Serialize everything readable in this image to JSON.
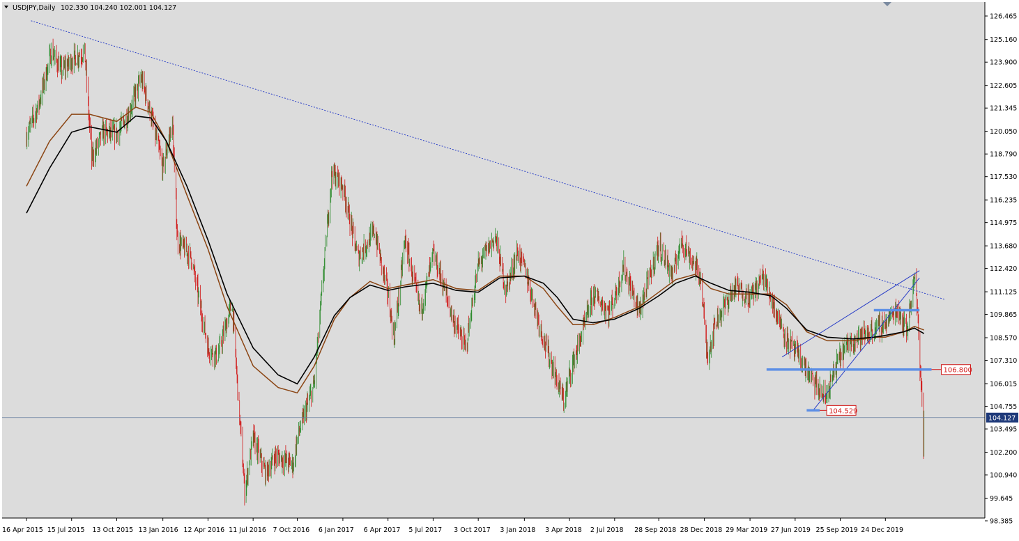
{
  "header": {
    "symbol_label": "USDJPY,Daily",
    "ohlc_label": "102.330 104.240 102.001 104.127"
  },
  "colors": {
    "background": "#dcdcdc",
    "bull": "#2e8b2e",
    "bear": "#d11a1a",
    "ma_fast": "#8b4513",
    "ma_slow": "#000000",
    "trendline": "#2a3fc7",
    "level": "#5b8ee6",
    "price_label_bg": "#1f3a7a",
    "level_label": "#d11a1a"
  },
  "chart_data": {
    "type": "candlestick",
    "symbol": "USDJPY",
    "timeframe": "Daily",
    "ohlc_last": {
      "open": 102.33,
      "high": 104.24,
      "low": 102.001,
      "close": 104.127
    },
    "ylim": [
      98.385,
      126.465
    ],
    "y_ticks": [
      "126.465",
      "125.160",
      "123.900",
      "122.605",
      "121.345",
      "120.050",
      "118.790",
      "117.530",
      "116.235",
      "114.975",
      "113.680",
      "112.420",
      "111.125",
      "109.865",
      "108.570",
      "107.310",
      "106.015",
      "104.755",
      "103.495",
      "102.200",
      "100.940",
      "99.645",
      "98.385"
    ],
    "x_ticks": [
      "16 Apr 2015",
      "15 Jul 2015",
      "13 Oct 2015",
      "13 Jan 2016",
      "12 Apr 2016",
      "11 Jul 2016",
      "7 Oct 2016",
      "6 Jan 2017",
      "6 Apr 2017",
      "5 Jul 2017",
      "3 Oct 2017",
      "3 Jan 2018",
      "3 Apr 2018",
      "2 Jul 2018",
      "28 Sep 2018",
      "28 Dec 2018",
      "29 Mar 2019",
      "27 Jun 2019",
      "25 Sep 2019",
      "24 Dec 2019"
    ],
    "close_path": [
      [
        "2015-04-16",
        119.8
      ],
      [
        "2015-05-10",
        121.5
      ],
      [
        "2015-06-05",
        124.5
      ],
      [
        "2015-06-25",
        123.4
      ],
      [
        "2015-07-15",
        124.0
      ],
      [
        "2015-08-10",
        124.5
      ],
      [
        "2015-08-24",
        118.5
      ],
      [
        "2015-09-15",
        120.0
      ],
      [
        "2015-10-13",
        119.9
      ],
      [
        "2015-11-05",
        121.0
      ],
      [
        "2015-12-01",
        123.0
      ],
      [
        "2015-12-20",
        121.0
      ],
      [
        "2016-01-13",
        118.0
      ],
      [
        "2016-02-01",
        120.5
      ],
      [
        "2016-02-11",
        114.0
      ],
      [
        "2016-03-10",
        113.0
      ],
      [
        "2016-04-12",
        108.0
      ],
      [
        "2016-05-01",
        107.5
      ],
      [
        "2016-05-30",
        110.5
      ],
      [
        "2016-06-24",
        100.0
      ],
      [
        "2016-07-11",
        103.0
      ],
      [
        "2016-08-05",
        101.0
      ],
      [
        "2016-08-25",
        102.0
      ],
      [
        "2016-09-30",
        101.5
      ],
      [
        "2016-10-07",
        103.0
      ],
      [
        "2016-11-10",
        106.0
      ],
      [
        "2016-12-15",
        117.8
      ],
      [
        "2017-01-06",
        117.0
      ],
      [
        "2017-02-05",
        113.0
      ],
      [
        "2017-03-10",
        114.5
      ],
      [
        "2017-04-06",
        111.0
      ],
      [
        "2017-04-18",
        108.5
      ],
      [
        "2017-05-10",
        114.0
      ],
      [
        "2017-06-10",
        110.0
      ],
      [
        "2017-07-05",
        113.2
      ],
      [
        "2017-07-20",
        112.0
      ],
      [
        "2017-08-15",
        109.5
      ],
      [
        "2017-09-08",
        108.0
      ],
      [
        "2017-10-03",
        112.6
      ],
      [
        "2017-11-06",
        114.2
      ],
      [
        "2017-11-27",
        111.2
      ],
      [
        "2017-12-20",
        113.3
      ],
      [
        "2018-01-03",
        112.5
      ],
      [
        "2018-02-10",
        108.5
      ],
      [
        "2018-03-23",
        105.0
      ],
      [
        "2018-04-03",
        106.5
      ],
      [
        "2018-05-21",
        111.0
      ],
      [
        "2018-06-20",
        110.0
      ],
      [
        "2018-07-02",
        110.8
      ],
      [
        "2018-07-20",
        112.5
      ],
      [
        "2018-08-20",
        110.0
      ],
      [
        "2018-09-28",
        113.7
      ],
      [
        "2018-10-26",
        112.0
      ],
      [
        "2018-11-12",
        114.0
      ],
      [
        "2018-12-20",
        112.0
      ],
      [
        "2019-01-03",
        107.5
      ],
      [
        "2019-01-20",
        109.5
      ],
      [
        "2019-02-28",
        111.4
      ],
      [
        "2019-03-29",
        110.8
      ],
      [
        "2019-04-24",
        112.0
      ],
      [
        "2019-05-20",
        110.0
      ],
      [
        "2019-06-10",
        108.5
      ],
      [
        "2019-06-27",
        107.8
      ],
      [
        "2019-08-05",
        106.0
      ],
      [
        "2019-08-26",
        105.2
      ],
      [
        "2019-09-25",
        107.6
      ],
      [
        "2019-10-20",
        108.5
      ],
      [
        "2019-11-20",
        108.8
      ],
      [
        "2019-12-24",
        109.4
      ],
      [
        "2020-01-17",
        110.2
      ],
      [
        "2020-02-05",
        109.0
      ],
      [
        "2020-02-20",
        112.0
      ],
      [
        "2020-02-26",
        110.0
      ],
      [
        "2020-03-02",
        107.0
      ],
      [
        "2020-03-06",
        105.3
      ],
      [
        "2020-03-09",
        102.2
      ],
      [
        "2020-03-10",
        104.127
      ]
    ],
    "ma_slow_path": [
      [
        "2015-04-16",
        115.5
      ],
      [
        "2015-06-01",
        118.0
      ],
      [
        "2015-07-15",
        120.0
      ],
      [
        "2015-08-20",
        120.3
      ],
      [
        "2015-10-13",
        120.0
      ],
      [
        "2015-11-20",
        120.9
      ],
      [
        "2015-12-20",
        120.8
      ],
      [
        "2016-01-20",
        119.5
      ],
      [
        "2016-03-01",
        117.0
      ],
      [
        "2016-04-12",
        114.0
      ],
      [
        "2016-05-20",
        111.0
      ],
      [
        "2016-07-11",
        108.0
      ],
      [
        "2016-08-30",
        106.5
      ],
      [
        "2016-10-07",
        106.0
      ],
      [
        "2016-11-10",
        107.5
      ],
      [
        "2016-12-20",
        109.8
      ],
      [
        "2017-01-20",
        110.8
      ],
      [
        "2017-03-01",
        111.5
      ],
      [
        "2017-04-06",
        111.2
      ],
      [
        "2017-05-10",
        111.4
      ],
      [
        "2017-07-05",
        111.6
      ],
      [
        "2017-08-20",
        111.2
      ],
      [
        "2017-10-03",
        111.1
      ],
      [
        "2017-11-15",
        111.9
      ],
      [
        "2018-01-03",
        112.0
      ],
      [
        "2018-02-10",
        111.6
      ],
      [
        "2018-03-10",
        110.8
      ],
      [
        "2018-04-10",
        109.6
      ],
      [
        "2018-05-20",
        109.4
      ],
      [
        "2018-07-02",
        109.6
      ],
      [
        "2018-08-20",
        110.2
      ],
      [
        "2018-09-28",
        110.9
      ],
      [
        "2018-11-01",
        111.6
      ],
      [
        "2018-12-10",
        112.0
      ],
      [
        "2019-01-10",
        111.6
      ],
      [
        "2019-02-15",
        111.2
      ],
      [
        "2019-03-29",
        111.1
      ],
      [
        "2019-05-10",
        110.9
      ],
      [
        "2019-06-10",
        110.2
      ],
      [
        "2019-07-20",
        109.0
      ],
      [
        "2019-08-30",
        108.6
      ],
      [
        "2019-10-20",
        108.5
      ],
      [
        "2019-12-01",
        108.6
      ],
      [
        "2019-12-24",
        108.7
      ],
      [
        "2020-01-30",
        108.9
      ],
      [
        "2020-02-20",
        109.1
      ],
      [
        "2020-03-10",
        108.8
      ]
    ],
    "ma_fast_path": [
      [
        "2015-04-16",
        117.0
      ],
      [
        "2015-06-01",
        119.5
      ],
      [
        "2015-07-15",
        121.0
      ],
      [
        "2015-08-20",
        121.0
      ],
      [
        "2015-10-13",
        120.6
      ],
      [
        "2015-11-20",
        121.4
      ],
      [
        "2015-12-20",
        121.1
      ],
      [
        "2016-01-20",
        119.5
      ],
      [
        "2016-03-01",
        116.5
      ],
      [
        "2016-04-12",
        113.5
      ],
      [
        "2016-05-20",
        110.3
      ],
      [
        "2016-07-11",
        107.0
      ],
      [
        "2016-08-30",
        105.8
      ],
      [
        "2016-10-07",
        105.5
      ],
      [
        "2016-11-10",
        107.0
      ],
      [
        "2016-12-20",
        109.6
      ],
      [
        "2017-01-20",
        110.8
      ],
      [
        "2017-03-01",
        111.7
      ],
      [
        "2017-04-06",
        111.3
      ],
      [
        "2017-05-10",
        111.5
      ],
      [
        "2017-07-05",
        111.8
      ],
      [
        "2017-08-20",
        111.3
      ],
      [
        "2017-10-03",
        111.2
      ],
      [
        "2017-11-15",
        112.0
      ],
      [
        "2018-01-03",
        112.0
      ],
      [
        "2018-02-10",
        111.3
      ],
      [
        "2018-03-10",
        110.3
      ],
      [
        "2018-04-10",
        109.3
      ],
      [
        "2018-05-20",
        109.3
      ],
      [
        "2018-07-02",
        109.7
      ],
      [
        "2018-08-20",
        110.3
      ],
      [
        "2018-09-28",
        111.1
      ],
      [
        "2018-11-01",
        111.8
      ],
      [
        "2018-12-10",
        112.1
      ],
      [
        "2019-01-10",
        111.3
      ],
      [
        "2019-02-15",
        111.0
      ],
      [
        "2019-03-29",
        111.0
      ],
      [
        "2019-05-10",
        111.0
      ],
      [
        "2019-06-10",
        110.4
      ],
      [
        "2019-07-20",
        108.9
      ],
      [
        "2019-08-30",
        108.4
      ],
      [
        "2019-10-20",
        108.4
      ],
      [
        "2019-12-01",
        108.6
      ],
      [
        "2019-12-24",
        108.6
      ],
      [
        "2020-01-30",
        108.9
      ],
      [
        "2020-02-20",
        109.2
      ],
      [
        "2020-03-10",
        109.0
      ]
    ],
    "trendline": [
      [
        "2015-04-25",
        126.2
      ],
      [
        "2020-04-20",
        110.7
      ]
    ],
    "channel_lower": [
      [
        "2019-08-01",
        104.5
      ],
      [
        "2020-03-01",
        111.9
      ]
    ],
    "channel_upper": [
      [
        "2019-06-01",
        107.5
      ],
      [
        "2020-03-01",
        112.3
      ]
    ],
    "support_level": {
      "value": 106.8,
      "label": "106.800",
      "from": "2019-05-01",
      "to": "2020-03-25"
    },
    "support_level_2": {
      "value": 104.529,
      "label": "104.529",
      "from": "2019-07-20",
      "to": "2019-08-15"
    },
    "resistance_level": {
      "value": 110.1,
      "from": "2019-12-01",
      "to": "2020-03-01"
    },
    "current_price": {
      "value": 104.127,
      "label": "104.127"
    }
  }
}
